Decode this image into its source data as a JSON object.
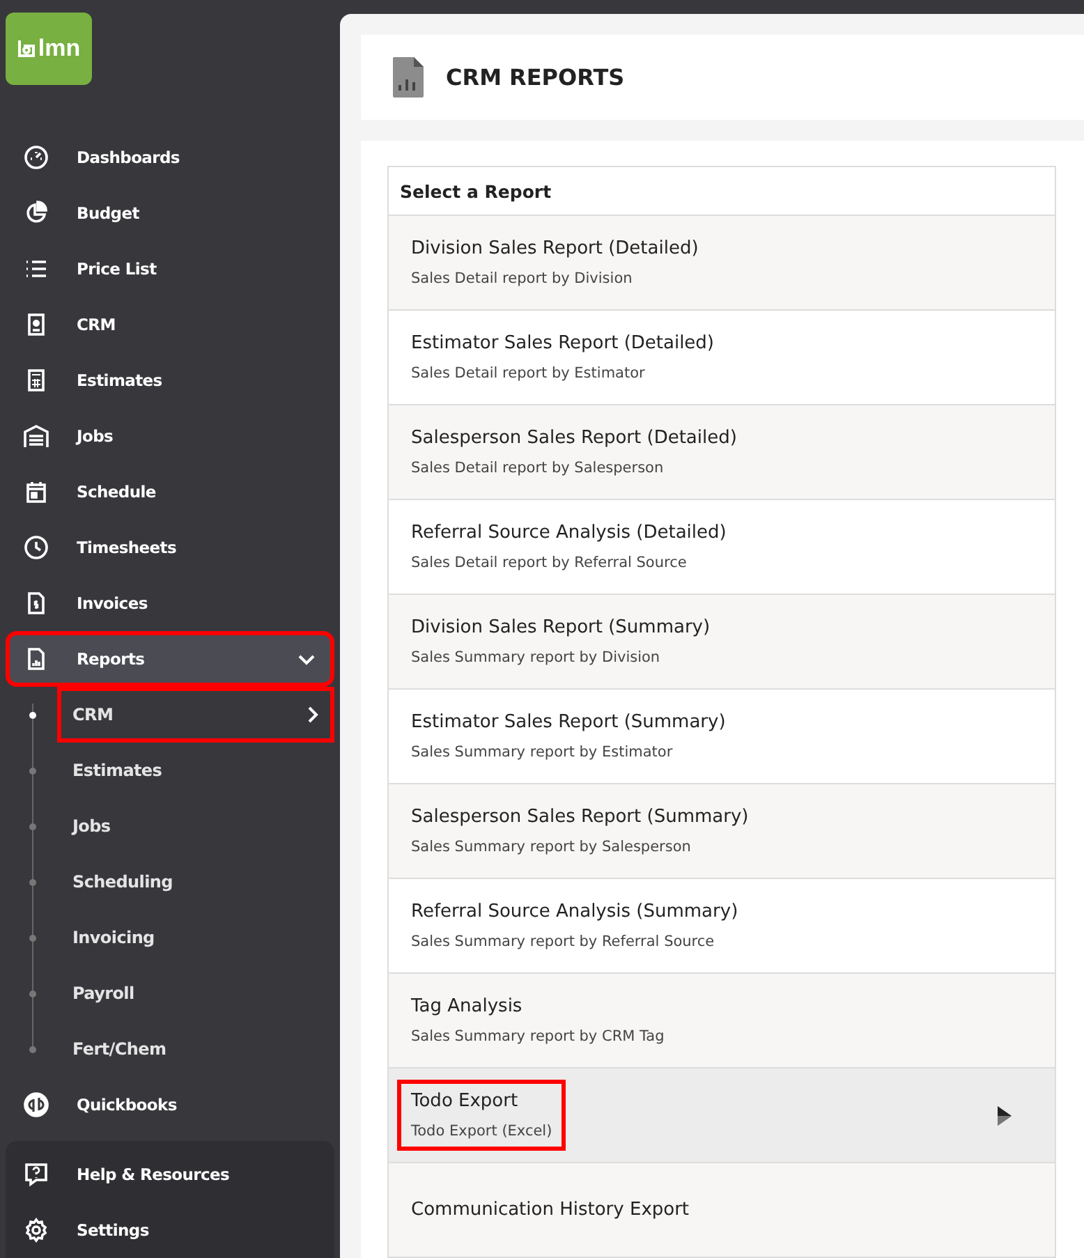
{
  "logo": {
    "text": "lmn"
  },
  "nav": [
    {
      "label": "Dashboards",
      "selected": false,
      "highlighted": false
    },
    {
      "label": "Budget",
      "selected": false,
      "highlighted": false
    },
    {
      "label": "Price List",
      "selected": false,
      "highlighted": false
    },
    {
      "label": "CRM",
      "selected": false,
      "highlighted": false
    },
    {
      "label": "Estimates",
      "selected": false,
      "highlighted": false
    },
    {
      "label": "Jobs",
      "selected": false,
      "highlighted": false
    },
    {
      "label": "Schedule",
      "selected": false,
      "highlighted": false
    },
    {
      "label": "Timesheets",
      "selected": false,
      "highlighted": false
    },
    {
      "label": "Invoices",
      "selected": false,
      "highlighted": false
    },
    {
      "label": "Reports",
      "selected": true,
      "highlighted": true,
      "expanded": true,
      "children": [
        {
          "label": "CRM",
          "selected": true,
          "highlighted": true
        },
        {
          "label": "Estimates",
          "selected": false,
          "highlighted": false
        },
        {
          "label": "Jobs",
          "selected": false,
          "highlighted": false
        },
        {
          "label": "Scheduling",
          "selected": false,
          "highlighted": false
        },
        {
          "label": "Invoicing",
          "selected": false,
          "highlighted": false
        },
        {
          "label": "Payroll",
          "selected": false,
          "highlighted": false
        },
        {
          "label": "Fert/Chem",
          "selected": false,
          "highlighted": false
        }
      ]
    },
    {
      "label": "Quickbooks",
      "selected": false,
      "highlighted": false
    }
  ],
  "footer_nav": [
    {
      "label": "Help & Resources"
    },
    {
      "label": "Settings"
    }
  ],
  "page": {
    "title": "CRM REPORTS"
  },
  "report_list": {
    "heading": "Select a Report",
    "rows": [
      {
        "title": "Division Sales Report (Detailed)",
        "subtitle": "Sales Detail report by Division",
        "hovered": false,
        "highlighted": false
      },
      {
        "title": "Estimator Sales Report (Detailed)",
        "subtitle": "Sales Detail report by Estimator",
        "hovered": false,
        "highlighted": false
      },
      {
        "title": "Salesperson Sales Report (Detailed)",
        "subtitle": "Sales Detail report by Salesperson",
        "hovered": false,
        "highlighted": false
      },
      {
        "title": "Referral Source Analysis (Detailed)",
        "subtitle": "Sales Detail report by Referral Source",
        "hovered": false,
        "highlighted": false
      },
      {
        "title": "Division Sales Report (Summary)",
        "subtitle": "Sales Summary report by Division",
        "hovered": false,
        "highlighted": false
      },
      {
        "title": "Estimator Sales Report (Summary)",
        "subtitle": "Sales Summary report by Estimator",
        "hovered": false,
        "highlighted": false
      },
      {
        "title": "Salesperson Sales Report (Summary)",
        "subtitle": "Sales Summary report by Salesperson",
        "hovered": false,
        "highlighted": false
      },
      {
        "title": "Referral Source Analysis (Summary)",
        "subtitle": "Sales Summary report by Referral Source",
        "hovered": false,
        "highlighted": false
      },
      {
        "title": "Tag Analysis",
        "subtitle": "Sales Summary report by CRM Tag",
        "hovered": false,
        "highlighted": false
      },
      {
        "title": "Todo Export",
        "subtitle": "Todo Export (Excel)",
        "hovered": true,
        "highlighted": true
      },
      {
        "title": "Communication History Export",
        "hovered": false,
        "highlighted": false
      }
    ]
  }
}
